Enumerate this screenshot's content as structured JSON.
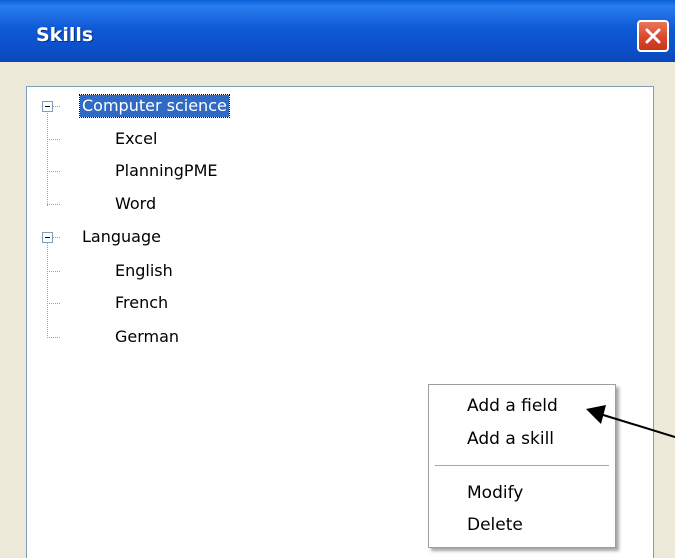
{
  "window": {
    "title": "Skills",
    "close_icon": "close-icon",
    "colors": {
      "titlebar": "#0b55d0",
      "close": "#d9472c",
      "selection": "#316ac5"
    }
  },
  "tree": {
    "categories": [
      {
        "label": "Computer science",
        "expanded": true,
        "selected": true,
        "items": [
          "Excel",
          "PlanningPME",
          "Word"
        ]
      },
      {
        "label": "Language",
        "expanded": true,
        "selected": false,
        "items": [
          "English",
          "French",
          "German"
        ]
      }
    ]
  },
  "context_menu": {
    "items": [
      {
        "label": "Add a field"
      },
      {
        "label": "Add a skill"
      },
      {
        "label": "Modify"
      },
      {
        "label": "Delete"
      }
    ]
  },
  "annotation": {
    "pointer_icon": "arrow-icon"
  }
}
